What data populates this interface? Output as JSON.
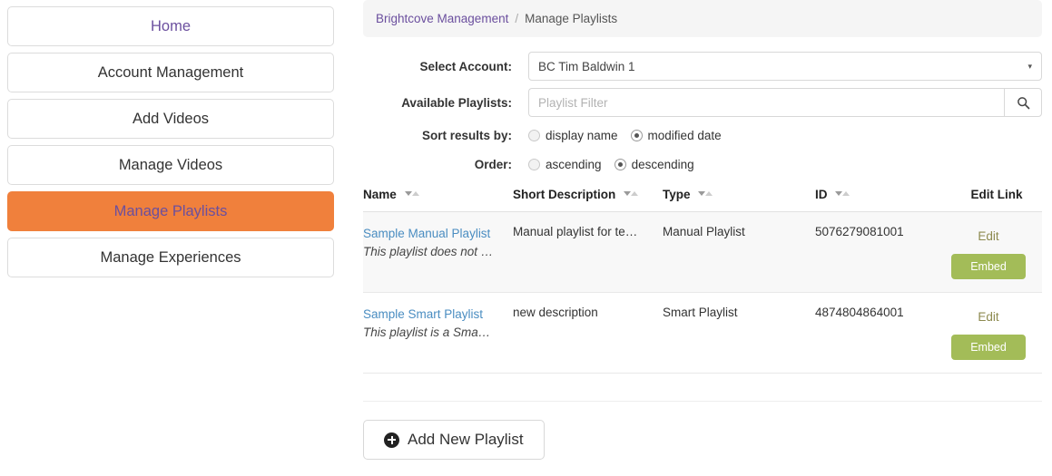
{
  "sidebar": {
    "items": [
      {
        "label": "Home",
        "active": false,
        "purple": true
      },
      {
        "label": "Account Management",
        "active": false,
        "purple": false
      },
      {
        "label": "Add Videos",
        "active": false,
        "purple": false
      },
      {
        "label": "Manage Videos",
        "active": false,
        "purple": false
      },
      {
        "label": "Manage Playlists",
        "active": true,
        "purple": false
      },
      {
        "label": "Manage Experiences",
        "active": false,
        "purple": false
      }
    ]
  },
  "breadcrumb": {
    "root": "Brightcove Management",
    "separator": "/",
    "current": "Manage Playlists"
  },
  "form": {
    "select_account": {
      "label": "Select Account:",
      "value": "BC Tim Baldwin 1",
      "caret": "▾"
    },
    "available_playlists": {
      "label": "Available Playlists:",
      "value": "",
      "placeholder": "Playlist Filter",
      "search_icon": "search-icon"
    },
    "sort_results_by": {
      "label": "Sort results by:",
      "options": [
        {
          "label": "display name",
          "checked": false
        },
        {
          "label": "modified date",
          "checked": true
        }
      ]
    },
    "order": {
      "label": "Order:",
      "options": [
        {
          "label": "ascending",
          "checked": false
        },
        {
          "label": "descending",
          "checked": true
        }
      ]
    }
  },
  "table": {
    "columns": [
      {
        "label": "Name",
        "sortable": true
      },
      {
        "label": "Short Description",
        "sortable": true
      },
      {
        "label": "Type",
        "sortable": true
      },
      {
        "label": "ID",
        "sortable": true
      },
      {
        "label": "Edit Link",
        "sortable": false
      }
    ],
    "rows": [
      {
        "name": "Sample Manual Playlist",
        "subtitle": "This playlist does not …",
        "short_description": "Manual playlist for te…",
        "type": "Manual Playlist",
        "id": "5076279081001",
        "edit_label": "Edit",
        "embed_label": "Embed"
      },
      {
        "name": "Sample Smart Playlist",
        "subtitle": "This playlist is a Sma…",
        "short_description": "new description",
        "type": "Smart Playlist",
        "id": "4874804864001",
        "edit_label": "Edit",
        "embed_label": "Embed"
      }
    ]
  },
  "footer": {
    "add_playlist_label": "Add New Playlist",
    "add_icon": "plus-circle-icon"
  },
  "colors": {
    "active_nav_bg": "#f0803c",
    "active_nav_text": "#6b4f9e",
    "link_blue": "#4a8dc1",
    "embed_green": "#a3bc58",
    "edit_olive": "#8d8a4f",
    "breadcrumb_bg": "#f5f5f5"
  }
}
